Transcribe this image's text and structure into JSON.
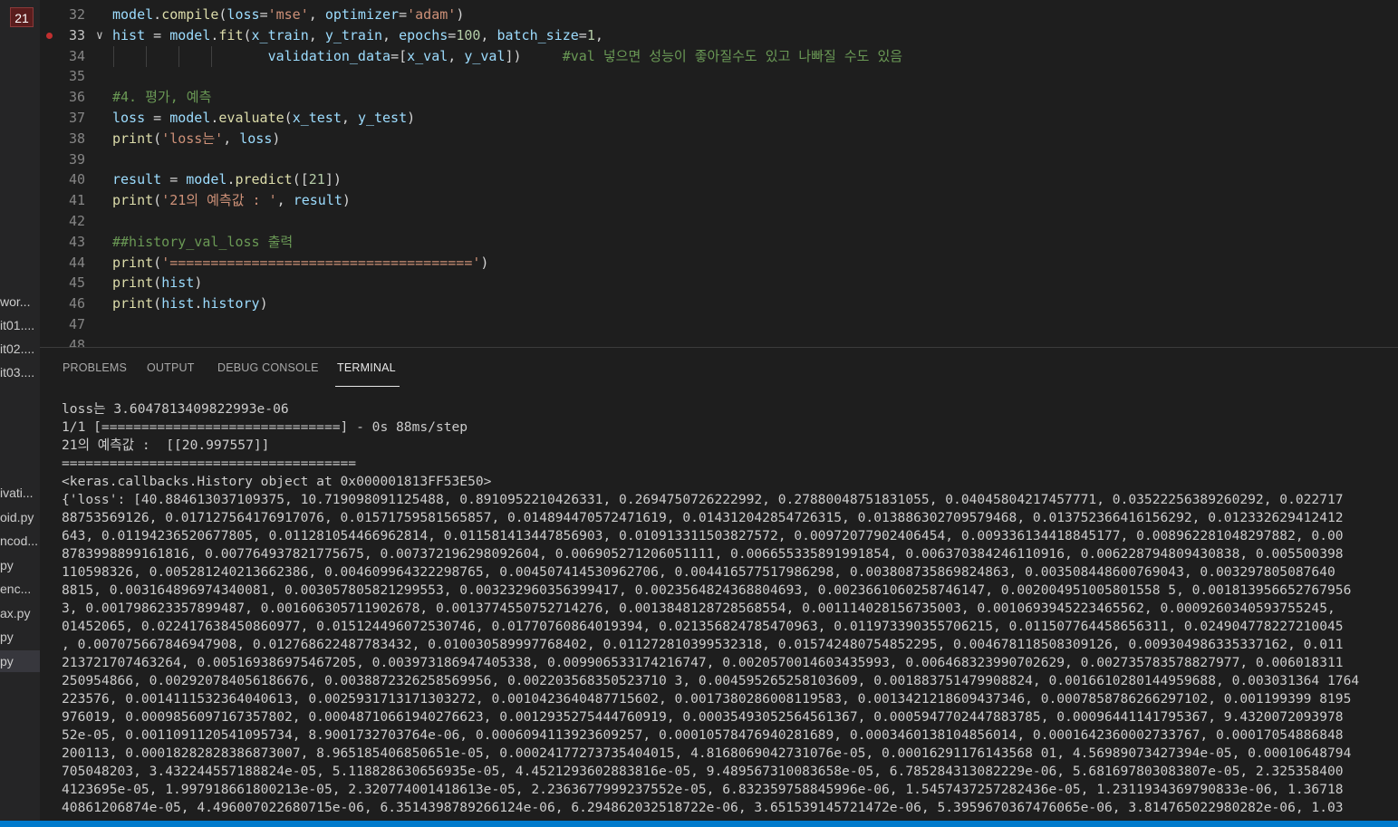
{
  "sidebar": {
    "badge": "21",
    "items": [
      {
        "label": "wor..."
      },
      {
        "label": "it01...."
      },
      {
        "label": "it02...."
      },
      {
        "label": "it03...."
      },
      {
        "label": "ivati..."
      },
      {
        "label": "oid.py"
      },
      {
        "label": "ncod..."
      },
      {
        "label": "py"
      },
      {
        "label": "enc..."
      },
      {
        "label": "ax.py"
      },
      {
        "label": "py"
      },
      {
        "label": "py"
      }
    ]
  },
  "editor": {
    "lines": [
      {
        "n": "32",
        "text": "model.compile(loss='mse', optimizer='adam')"
      },
      {
        "n": "33",
        "text": "hist = model.fit(x_train, y_train, epochs=100, batch_size=1,"
      },
      {
        "n": "34",
        "text": "                   validation_data=[x_val, y_val])     #val 넣으면 성능이 좋아질수도 있고 나빠질 수도 있음"
      },
      {
        "n": "35",
        "text": ""
      },
      {
        "n": "36",
        "text": "#4. 평가, 예측"
      },
      {
        "n": "37",
        "text": "loss = model.evaluate(x_test, y_test)"
      },
      {
        "n": "38",
        "text": "print('loss는', loss)"
      },
      {
        "n": "39",
        "text": ""
      },
      {
        "n": "40",
        "text": "result = model.predict([21])"
      },
      {
        "n": "41",
        "text": "print('21의 예측값 : ', result)"
      },
      {
        "n": "42",
        "text": ""
      },
      {
        "n": "43",
        "text": "##history_val_loss 출력"
      },
      {
        "n": "44",
        "text": "print('=====================================')"
      },
      {
        "n": "45",
        "text": "print(hist)"
      },
      {
        "n": "46",
        "text": "print(hist.history)"
      },
      {
        "n": "47",
        "text": ""
      },
      {
        "n": "48",
        "text": ""
      }
    ]
  },
  "panel": {
    "tabs": [
      "PROBLEMS",
      "OUTPUT",
      "DEBUG CONSOLE",
      "TERMINAL"
    ],
    "active_tab": "TERMINAL",
    "terminal_lines": [
      "loss는 3.6047813409822993e-06",
      "1/1 [==============================] - 0s 88ms/step",
      "21의 예측값 :  [[20.997557]]",
      "=====================================",
      "<keras.callbacks.History object at 0x000001813FF53E50>",
      "{'loss': [40.884613037109375, 10.719098091125488, 0.8910952210426331, 0.2694750726222992, 0.27880048751831055, 0.04045804217457771, 0.03522256389260292, 0.022717",
      "88753569126, 0.017127564176917076, 0.01571759581565857, 0.014894470572471619, 0.014312042854726315, 0.013886302709579468, 0.013752366416156292, 0.012332629412412",
      "643, 0.01194236520677805, 0.011281054466962814, 0.011581413447856903, 0.010913311503827572, 0.00972077902406454, 0.009336134418845177, 0.008962281048297882, 0.00",
      "8783998899161816, 0.007764937821775675, 0.007372196298092604, 0.006905271206051111, 0.006655335891991854, 0.006370384246110916, 0.006228794809430838, 0.005500398",
      "110598326, 0.005281240213662386, 0.004609964322298765, 0.004507414530962706, 0.004416577517986298, 0.003808735869824863, 0.003508448600769043, 0.003297805087640",
      "8815, 0.003164896974340081, 0.003057805821299553, 0.003232960356399417, 0.0023564824368804693, 0.0023661060258746147, 0.002004951005801558 5, 0.001813956652767956",
      "3, 0.001798623357899487, 0.001606305711902678, 0.0013774550752714276, 0.0013848128728568554, 0.001114028156735003, 0.0010693945223465562, 0.0009260340593755245,",
      "01452065, 0.022417638450860977, 0.015124496072530746, 0.01770760864019394, 0.021356824785470963, 0.011973390355706215, 0.011507764458656311, 0.024904778227210045",
      ", 0.007075667846947908, 0.012768622487783432, 0.010030589997768402, 0.011272810399532318, 0.015742480754852295, 0.004678118508309126, 0.009304986335337162, 0.011",
      "213721707463264, 0.005169386975467205, 0.003973186947405338, 0.009906533174216747, 0.0020570014603435993, 0.006468323990702629, 0.002735783578827977, 0.006018311",
      "250954866, 0.002920784056186676, 0.0038872326258569956, 0.002203568350523710 3, 0.004595265258103609, 0.001883751479908824, 0.0016610280144959688, 0.003031364 1764",
      "223576, 0.0014111532364040613, 0.0025931713171303272, 0.0010423640487715602, 0.0017380286008119583, 0.0013421218609437346, 0.0007858786266297102, 0.001199399 8195",
      "976019, 0.0009856097167357802, 0.00048710661940276623, 0.0012935275444760919, 0.00035493052564561367, 0.0005947702447883785, 0.00096441141795367, 9.4320072093978",
      "52e-05, 0.0011091120541095734, 8.9001732703764e-06, 0.0006094113923609257, 0.00010578476940281689, 0.0003460138104856014, 0.0001642360002733767, 0.00017054886848",
      "200113, 0.00018282828386873007, 8.965185406850651e-05, 0.00024177273735404015, 4.8168069042731076e-05, 0.00016291176143568 01, 4.56989073427394e-05, 0.00010648794",
      "705048203, 3.432244557188824e-05, 5.118828630656935e-05, 4.4521293602883816e-05, 9.489567310083658e-05, 6.785284313082229e-06, 5.681697803083807e-05, 2.325358400",
      "4123695e-05, 1.997918661800213e-05, 2.320774001418613e-05, 2.2363677999237552e-05, 6.832359758845996e-06, 1.5457437257282436e-05, 1.2311934369790833e-06, 1.36718",
      "40861206874e-05, 4.496007022680715e-06, 6.3514398789266124e-06, 6.294862032518722e-06, 3.651539145721472e-06, 5.3959670367476065e-06, 3.814765022980282e-06, 1.03"
    ]
  },
  "colors": {
    "editor_bg": "#1e1e1e",
    "sidebar_bg": "#252526",
    "status_bar": "#007acc",
    "badge_bg": "#5a1d1d",
    "breakpoint": "#c12f2f"
  }
}
